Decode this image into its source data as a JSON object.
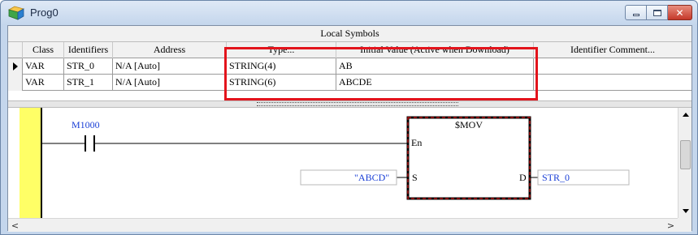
{
  "window": {
    "title": "Prog0"
  },
  "symbols": {
    "title": "Local Symbols",
    "headers": [
      "Class",
      "Identifiers",
      "Address",
      "Type...",
      "Initial Value (Active when Download)",
      "Identifier Comment..."
    ],
    "rows": [
      {
        "class": "VAR",
        "identifier": "STR_0",
        "address": "N/A [Auto]",
        "type": "STRING(4)",
        "initial": "AB",
        "comment": ""
      },
      {
        "class": "VAR",
        "identifier": "STR_1",
        "address": "N/A [Auto]",
        "type": "STRING(6)",
        "initial": "ABCDE",
        "comment": ""
      }
    ]
  },
  "ladder": {
    "contact_label": "M1000",
    "block_title": "$MOV",
    "pin_en": "En",
    "pin_s": "S",
    "pin_d": "D",
    "input_operand": "\"ABCD\"",
    "output_operand": "STR_0"
  },
  "colors": {
    "highlight": "#e3141c",
    "rail": "#ffff66",
    "operand": "#1a3fd6"
  },
  "icons": {
    "app": "folder-program-icon",
    "minimize": "minimize-icon",
    "maximize": "maximize-icon",
    "close": "close-icon"
  }
}
